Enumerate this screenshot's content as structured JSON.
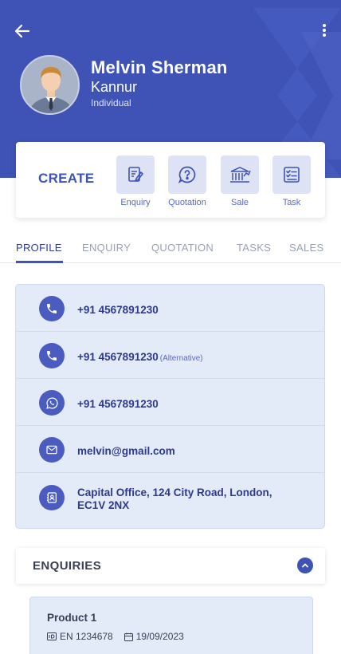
{
  "colors": {
    "brand": "#3e53b5",
    "card_bg": "#e4ebf8",
    "text_dark": "#2d3a8c"
  },
  "header": {
    "back_icon": "arrow-left-icon",
    "more_icon": "more-vertical-icon",
    "name": "Melvin Sherman",
    "city": "Kannur",
    "type": "Individual"
  },
  "create": {
    "label": "CREATE",
    "actions": [
      {
        "label": "Enquiry",
        "icon": "enquiry-icon"
      },
      {
        "label": "Quotation",
        "icon": "question-icon"
      },
      {
        "label": "Sale",
        "icon": "bank-chart-icon"
      },
      {
        "label": "Task",
        "icon": "checklist-icon"
      }
    ]
  },
  "tabs": [
    {
      "label": "PROFILE",
      "active": true
    },
    {
      "label": "ENQUIRY",
      "active": false
    },
    {
      "label": "QUOTATION",
      "active": false
    },
    {
      "label": "TASKS",
      "active": false
    },
    {
      "label": "SALES",
      "active": false
    }
  ],
  "contacts": [
    {
      "icon": "phone-icon",
      "value": "+91 4567891230",
      "note": ""
    },
    {
      "icon": "phone-icon",
      "value": "+91 4567891230",
      "note": "(Alternative)"
    },
    {
      "icon": "whatsapp-icon",
      "value": "+91 4567891230",
      "note": ""
    },
    {
      "icon": "mail-icon",
      "value": "melvin@gmail.com",
      "note": ""
    },
    {
      "icon": "address-book-icon",
      "value": "Capital Office, 124 City Road, London, EC1V 2NX",
      "note": ""
    }
  ],
  "enquiries": {
    "title": "ENQUIRIES",
    "items": [
      {
        "product": "Product 1",
        "id": "EN 1234678",
        "date": "19/09/2023"
      }
    ]
  }
}
